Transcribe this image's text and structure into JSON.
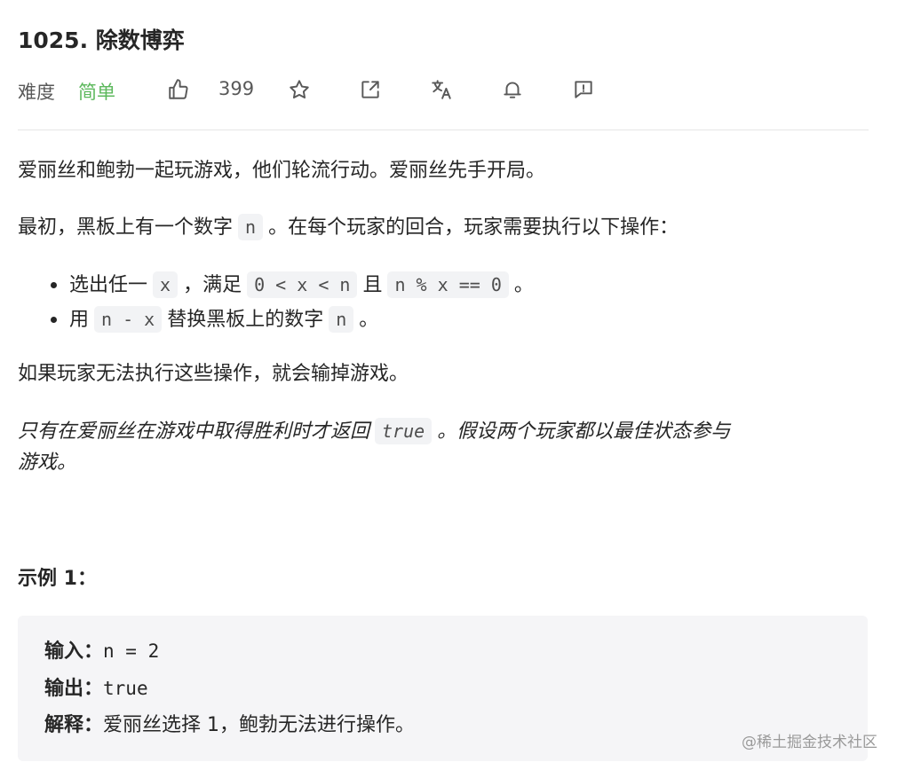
{
  "problem": {
    "title": "1025. 除数博弈",
    "difficulty_label": "难度",
    "difficulty_value": "简单",
    "like_count": "399"
  },
  "icons": {
    "like": "thumbs-up-icon",
    "favorite": "star-icon",
    "share": "share-icon",
    "translate": "translate-icon",
    "notify": "bell-icon",
    "feedback": "feedback-icon"
  },
  "description": {
    "p1": "爱丽丝和鲍勃一起玩游戏，他们轮流行动。爱丽丝先手开局。",
    "p2_before": "最初，黑板上有一个数字",
    "p2_code": "n",
    "p2_after": "。在每个玩家的回合，玩家需要执行以下操作：",
    "bullet1_a": "选出任一",
    "bullet1_code1": "x",
    "bullet1_b": "，满足",
    "bullet1_code2": "0 < x < n",
    "bullet1_c": "且",
    "bullet1_code3": "n % x == 0",
    "bullet1_d": "。",
    "bullet2_a": "用",
    "bullet2_code1": "n - x",
    "bullet2_b": "替换黑板上的数字",
    "bullet2_code2": "n",
    "bullet2_c": "。",
    "p3": "如果玩家无法执行这些操作，就会输掉游戏。",
    "p4_before": "只有在爱丽丝在游戏中取得胜利时才返回",
    "p4_code": "true",
    "p4_after": "。假设两个玩家都以最佳状态参与",
    "p4_line2": "游戏。"
  },
  "example": {
    "heading": "示例 1：",
    "input_label": "输入：",
    "input_value": "n = 2",
    "output_label": "输出：",
    "output_value": "true",
    "explain_label": "解释：",
    "explain_value": "爱丽丝选择 1，鲍勃无法进行操作。"
  },
  "watermark": "@稀土掘金技术社区",
  "colors": {
    "easy": "#5cb85c",
    "code_bg": "#f2f3f5",
    "example_bg": "#f5f5f7"
  }
}
